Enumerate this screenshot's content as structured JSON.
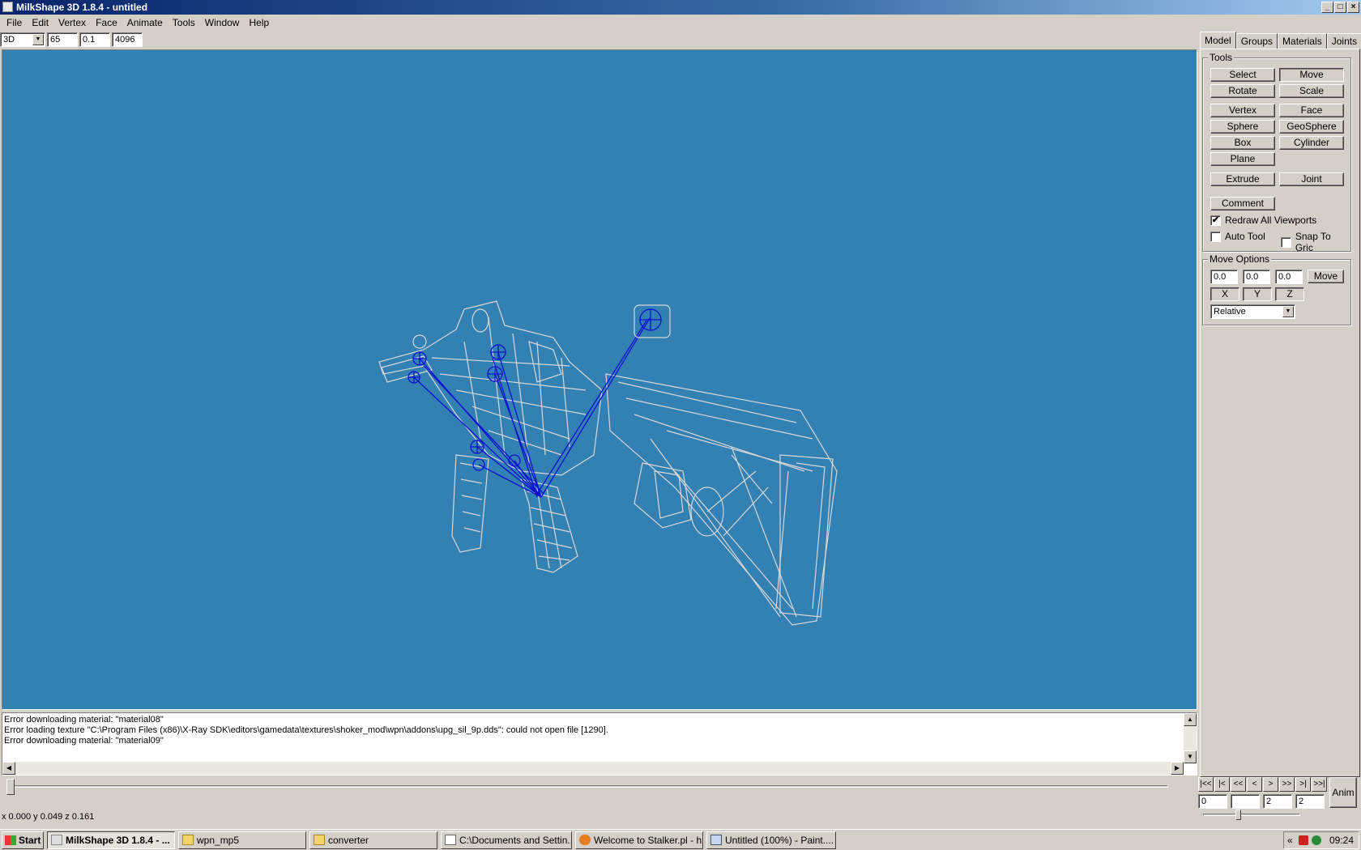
{
  "window": {
    "title": "MilkShape 3D 1.8.4 - untitled"
  },
  "menu": [
    "File",
    "Edit",
    "Vertex",
    "Face",
    "Animate",
    "Tools",
    "Window",
    "Help"
  ],
  "viewport_bar": {
    "view": "3D",
    "fov": "65",
    "near": "0.1",
    "far": "4096"
  },
  "tabs": [
    "Model",
    "Groups",
    "Materials",
    "Joints"
  ],
  "tools": {
    "label": "Tools",
    "select": "Select",
    "move": "Move",
    "rotate": "Rotate",
    "scale": "Scale",
    "vertex": "Vertex",
    "face": "Face",
    "sphere": "Sphere",
    "geosphere": "GeoSphere",
    "box": "Box",
    "cylinder": "Cylinder",
    "plane": "Plane",
    "extrude": "Extrude",
    "joint": "Joint",
    "comment": "Comment",
    "redraw": "Redraw All Viewports",
    "auto_tool": "Auto Tool",
    "snap": "Snap To Gric",
    "redraw_checked": "✔"
  },
  "move_options": {
    "label": "Move Options",
    "x_val": "0.0",
    "y_val": "0.0",
    "z_val": "0.0",
    "move_btn": "Move",
    "x": "X",
    "y": "Y",
    "z": "Z",
    "mode": "Relative"
  },
  "log": [
    "Error downloading material: \"material08\"",
    "Error loading texture \"C:\\Program Files (x86)\\X-Ray SDK\\editors\\gamedata\\textures\\shoker_mod\\wpn\\addons\\upg_sil_9p.dds\": could not open file [1290].",
    "Error downloading material: \"material09\""
  ],
  "anim": {
    "nav": [
      "|<<",
      "|<",
      "<<",
      "<",
      ">",
      ">>",
      ">|",
      ">>|"
    ],
    "frame": "0",
    "blank": "",
    "start": "2",
    "end": "2",
    "anim_btn": "Anim"
  },
  "status": "x 0.000 y 0.049 z 0.161",
  "taskbar": {
    "start": "Start",
    "tasks": [
      "MilkShape 3D 1.8.4 - ...",
      "wpn_mp5",
      "converter",
      "C:\\Documents and Settin...",
      "Welcome to Stalker.pl - h...",
      "Untitled (100%) - Paint...."
    ],
    "clock": "09:24",
    "tray_arrow": "«"
  },
  "colors": {
    "viewport_bg": "#3380b3",
    "mesh": "#d8d8d8",
    "joint": "#1010d0"
  }
}
